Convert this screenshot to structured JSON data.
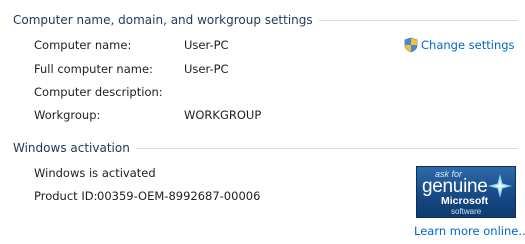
{
  "computer_section": {
    "header": "Computer name, domain, and workgroup settings",
    "rows": [
      {
        "label": "Computer name:",
        "value": "User-PC"
      },
      {
        "label": "Full computer name:",
        "value": "User-PC"
      },
      {
        "label": "Computer description:",
        "value": ""
      },
      {
        "label": "Workgroup:",
        "value": "WORKGROUP"
      }
    ],
    "change_settings_label": "Change settings",
    "change_settings_icon": "uac-shield-icon"
  },
  "activation_section": {
    "header": "Windows activation",
    "status": "Windows is activated",
    "product_id_label": "Product ID:",
    "product_id_value": "00359-OEM-8992687-00006",
    "badge": {
      "ask_for": "ask for",
      "genuine": "genuine",
      "microsoft": "Microsoft",
      "software": "software"
    },
    "learn_more_label": "Learn more online..."
  },
  "colors": {
    "header_text": "#1e395b",
    "rule": "#d5dfe5",
    "link": "#0066cc",
    "badge_blue": "#174a86"
  }
}
